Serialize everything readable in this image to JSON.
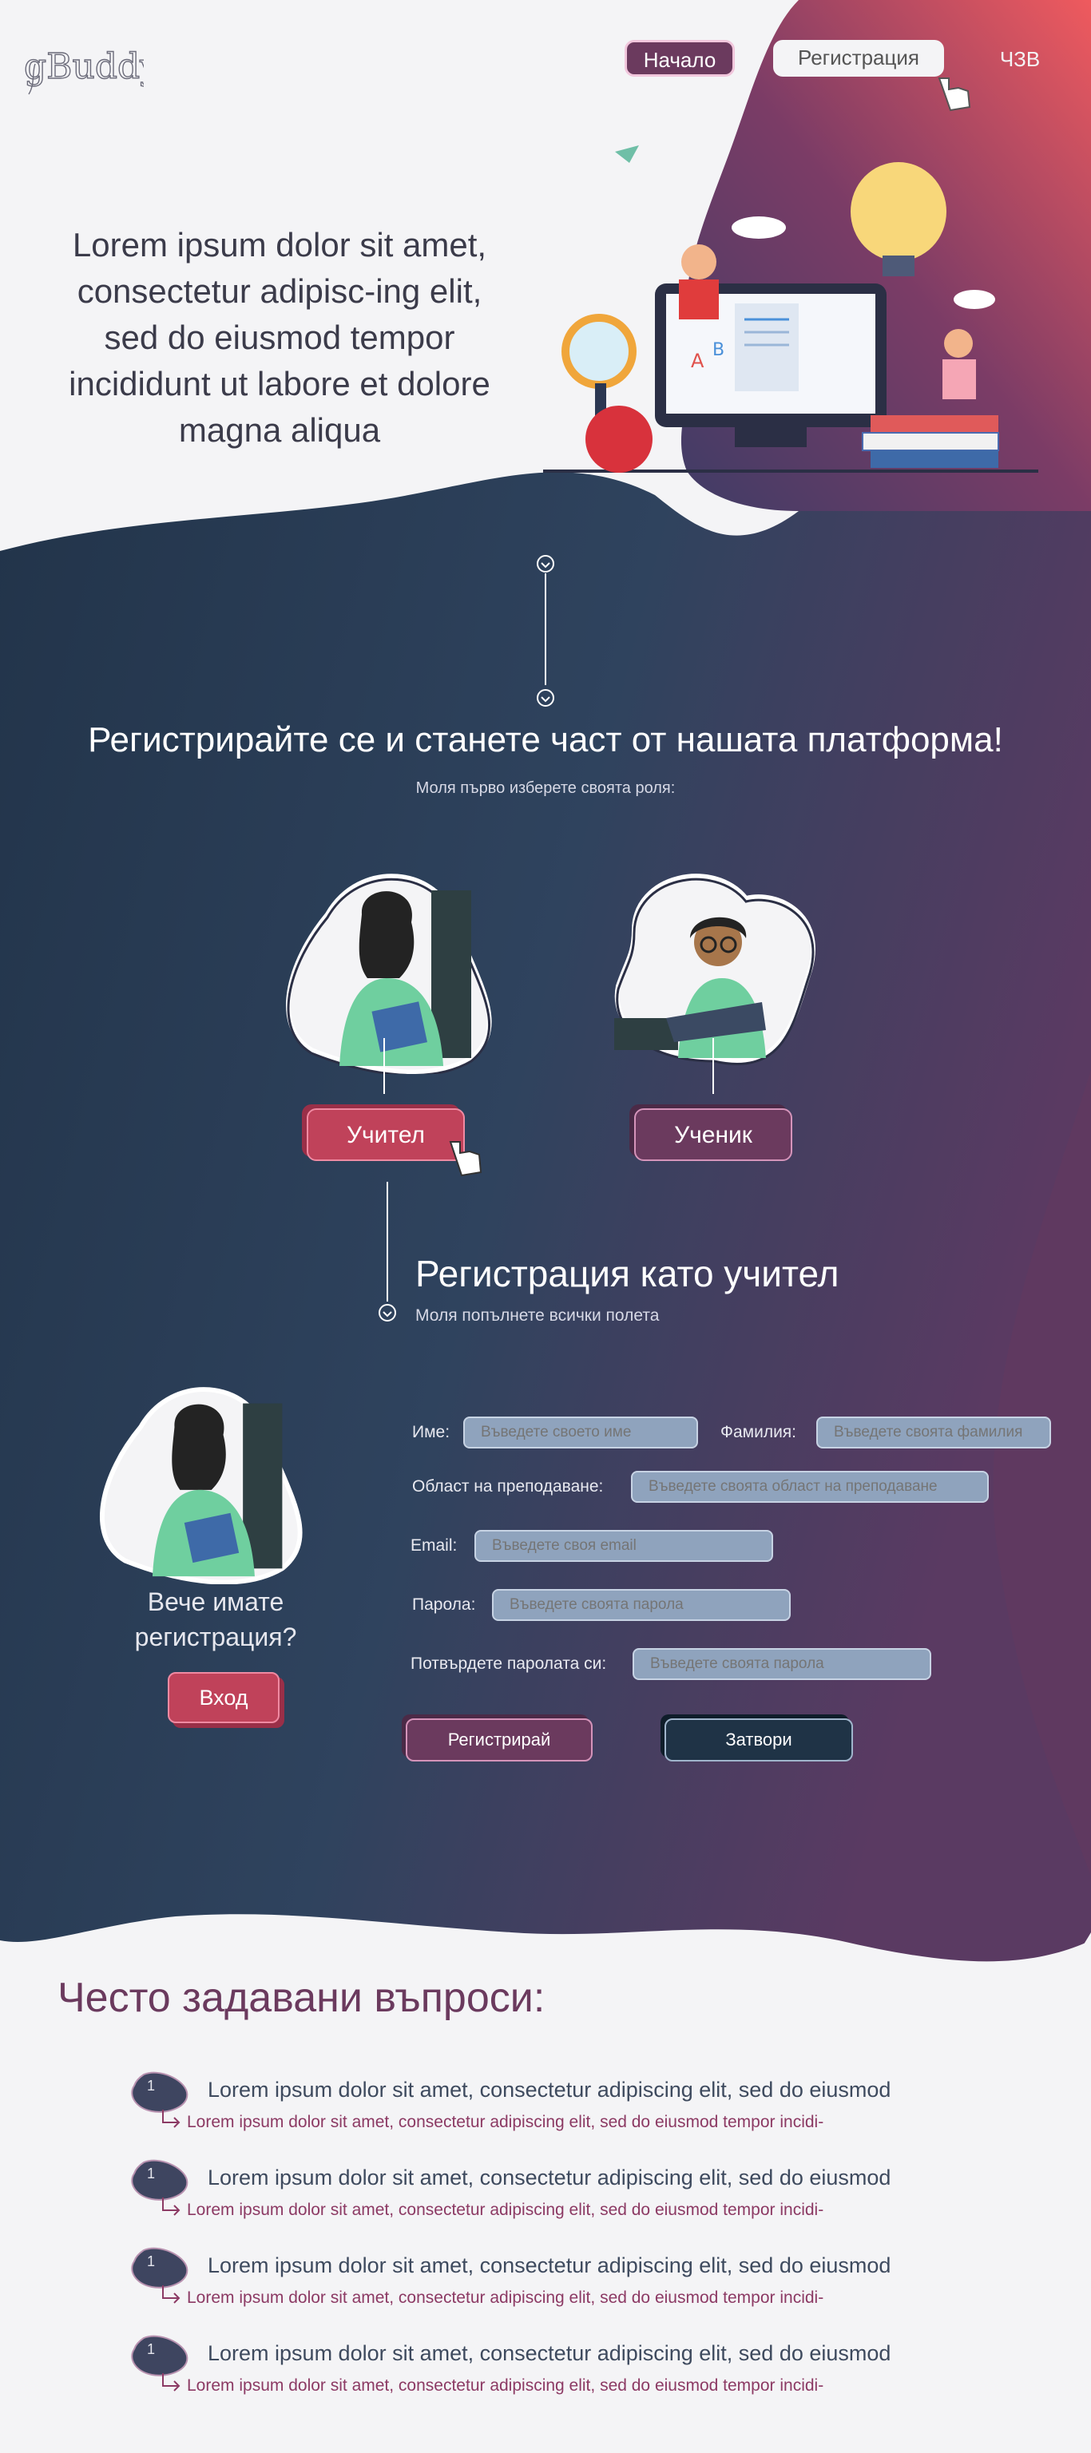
{
  "brand": {
    "logo_text": "gBuddy",
    "accent": "#6b3a5e",
    "pink": "#c0425a",
    "navy": "#22364a"
  },
  "nav": {
    "home": "Начало",
    "register": "Регистрация",
    "faq": "ЧЗВ"
  },
  "hero": {
    "text": "Lorem ipsum dolor sit amet, consectetur adipisc-ing elit, sed do eiusmod tempor incididunt ut labore et dolore magna aliqua"
  },
  "signup": {
    "title": "Регистрирайте се и станете част от нашата платформа!",
    "subtitle": "Моля първо изберете своята роля:",
    "roles": {
      "teacher": "Учител",
      "student": "Ученик"
    }
  },
  "form": {
    "title": "Регистрация като учител",
    "subtitle": "Моля попълнете всички полета",
    "first_name": {
      "label": "Име:",
      "placeholder": "Въведете своето име"
    },
    "last_name": {
      "label": "Фамилия:",
      "placeholder": "Въведете своята фамилия"
    },
    "subject": {
      "label": "Област на преподаване:",
      "placeholder": "Въведете своята област на преподаване"
    },
    "email": {
      "label": "Email:",
      "placeholder": "Въведете своя email"
    },
    "password": {
      "label": "Парола:",
      "placeholder": "Въведете своята парола"
    },
    "confirm": {
      "label": "Потвърдете паролата си:",
      "placeholder": "Въведете своята парола"
    },
    "submit": "Регистрирай",
    "close": "Затвори",
    "already": "Вече имате регистрация?",
    "login": "Вход"
  },
  "faq": {
    "title": "Често задавани въпроси:",
    "items": [
      {
        "num": "1",
        "q": "Lorem ipsum dolor sit amet, consectetur adipiscing elit, sed do eiusmod",
        "a": "Lorem ipsum dolor sit amet, consectetur adipiscing elit, sed do eiusmod tempor incidi-"
      },
      {
        "num": "1",
        "q": "Lorem ipsum dolor sit amet, consectetur adipiscing elit, sed do eiusmod",
        "a": "Lorem ipsum dolor sit amet, consectetur adipiscing elit, sed do eiusmod tempor incidi-"
      },
      {
        "num": "1",
        "q": "Lorem ipsum dolor sit amet, consectetur adipiscing elit, sed do eiusmod",
        "a": "Lorem ipsum dolor sit amet, consectetur adipiscing elit, sed do eiusmod tempor incidi-"
      },
      {
        "num": "1",
        "q": "Lorem ipsum dolor sit amet, consectetur adipiscing elit, sed do eiusmod",
        "a": "Lorem ipsum dolor sit amet, consectetur adipiscing elit, sed do eiusmod tempor incidi-"
      }
    ]
  }
}
